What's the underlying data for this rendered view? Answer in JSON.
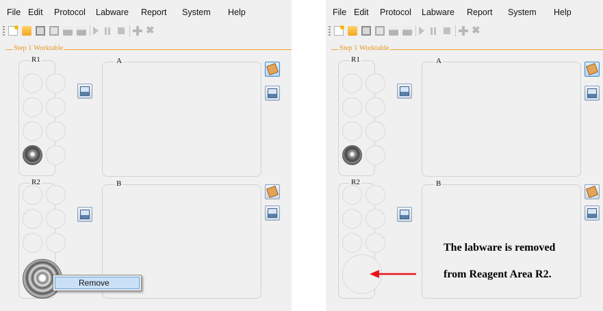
{
  "menu": [
    "File",
    "Edit",
    "Protocol",
    "Labware",
    "Report",
    "System",
    "Help"
  ],
  "step_label": "Step 1 Worktable",
  "areas": {
    "r1": "R1",
    "r2": "R2",
    "a": "A",
    "b": "B"
  },
  "context_menu": {
    "remove_label": "Remove"
  },
  "annotation": {
    "line1": "The labware is removed",
    "line2": "from Reagent Area R2."
  },
  "colors": {
    "step_accent": "#f2a224",
    "arrow": "#e8141a",
    "menu_highlight": "#c9e0f7"
  },
  "toolbar_icons": [
    "new-icon",
    "open-icon",
    "save-icon",
    "save-as-icon",
    "print-icon",
    "print-preview-icon",
    "play-icon",
    "pause-icon",
    "stop-icon",
    "add-icon",
    "delete-icon"
  ],
  "side_icons": [
    "labware-box-icon",
    "tip-rack-icon"
  ],
  "before": {
    "r1_filled": [
      false,
      false,
      false,
      false,
      false,
      false,
      true,
      false
    ],
    "r2_big_well_filled": true,
    "context_menu_visible": true
  },
  "after": {
    "r1_filled": [
      false,
      false,
      false,
      false,
      false,
      false,
      true,
      false
    ],
    "r2_big_well_filled": false,
    "context_menu_visible": false
  }
}
